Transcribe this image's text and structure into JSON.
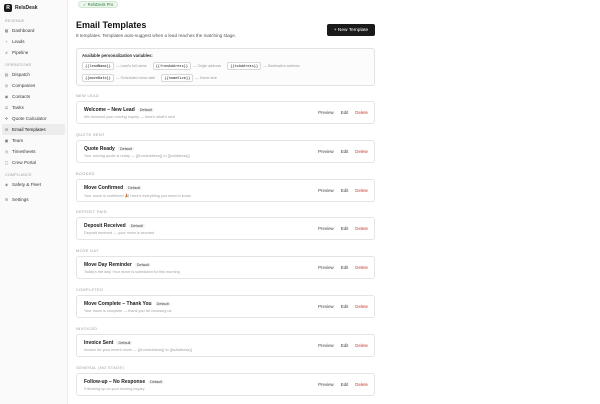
{
  "brand": {
    "mark": "R",
    "name": "RelsDesk"
  },
  "sidebar": {
    "sections": [
      {
        "label": "Revenue",
        "items": [
          {
            "icon": "dashboard-icon",
            "glyph": "▦",
            "label": "Dashboard"
          },
          {
            "icon": "leads-icon",
            "glyph": "+",
            "label": "Leads"
          },
          {
            "icon": "pipeline-icon",
            "glyph": "#",
            "label": "Pipeline"
          }
        ]
      },
      {
        "label": "Operations",
        "items": [
          {
            "icon": "dispatch-icon",
            "glyph": "▤",
            "label": "Dispatch"
          },
          {
            "icon": "companies-icon",
            "glyph": "◎",
            "label": "Companies"
          },
          {
            "icon": "contacts-icon",
            "glyph": "◉",
            "label": "Contacts"
          },
          {
            "icon": "tasks-icon",
            "glyph": "☑",
            "label": "Tasks"
          },
          {
            "icon": "quote-calculator-icon",
            "glyph": "✣",
            "label": "Quote Calculator"
          },
          {
            "icon": "email-templates-icon",
            "glyph": "✉",
            "label": "Email Templates",
            "active": true
          },
          {
            "icon": "team-icon",
            "glyph": "▣",
            "label": "Team"
          },
          {
            "icon": "timesheets-icon",
            "glyph": "◷",
            "label": "Timesheets"
          },
          {
            "icon": "crew-portal-icon",
            "glyph": "▢",
            "label": "Crew Portal"
          }
        ]
      },
      {
        "label": "Compliance",
        "items": [
          {
            "icon": "safety-fleet-icon",
            "glyph": "◈",
            "label": "Safety & Fleet"
          }
        ]
      }
    ],
    "settings": {
      "icon": "gear-icon",
      "glyph": "⚙",
      "label": "Settings"
    }
  },
  "topbar": {
    "badge": "✓ RelsDesk Pro"
  },
  "header": {
    "title": "Email Templates",
    "subtitle": "8 templates. Templates auto-suggest when a lead reaches the matching stage.",
    "new_button": "+ New Template"
  },
  "variables": {
    "title": "Available personalization variables:",
    "rows": [
      [
        {
          "token": "{{leadName}}",
          "desc": "— Lead's full name"
        },
        {
          "token": "{{fromAddress}}",
          "desc": "— Origin address"
        },
        {
          "token": "{{toAddress}}",
          "desc": "— Destination address"
        }
      ],
      [
        {
          "token": "{{moveDate}}",
          "desc": "— Scheduled move date"
        },
        {
          "token": "{{homeSize}}",
          "desc": "— Home size"
        }
      ]
    ]
  },
  "actions": {
    "preview": "Preview",
    "edit": "Edit",
    "delete": "Delete"
  },
  "sections": [
    {
      "stage": "New Lead",
      "name": "Welcome – New Lead",
      "badge": "Default",
      "subject": "We received your moving inquiry — here's what's next"
    },
    {
      "stage": "Quote Sent",
      "name": "Quote Ready",
      "badge": "Default",
      "subject": "Your moving quote is ready — {{fromAddress}} to {{toAddress}}"
    },
    {
      "stage": "Booked",
      "name": "Move Confirmed",
      "badge": "Default",
      "subject": "Your move is confirmed 🎉 Here's everything you need to know"
    },
    {
      "stage": "Deposit Paid",
      "name": "Deposit Received",
      "badge": "Default",
      "subject": "Deposit received — your move is secured"
    },
    {
      "stage": "Move Day",
      "name": "Move Day Reminder",
      "badge": "Default",
      "subject": "Today's the day! Your move is scheduled for this morning"
    },
    {
      "stage": "Completed",
      "name": "Move Complete – Thank You",
      "badge": "Default",
      "subject": "Your move is complete — thank you for choosing us"
    },
    {
      "stage": "Invoiced",
      "name": "Invoice Sent",
      "badge": "Default",
      "subject": "Invoice for your recent move — {{fromAddress}} to {{toAddress}}"
    },
    {
      "stage": "General (No Stage)",
      "name": "Follow-up – No Response",
      "badge": "Default",
      "subject": "Following up on your moving inquiry"
    }
  ]
}
